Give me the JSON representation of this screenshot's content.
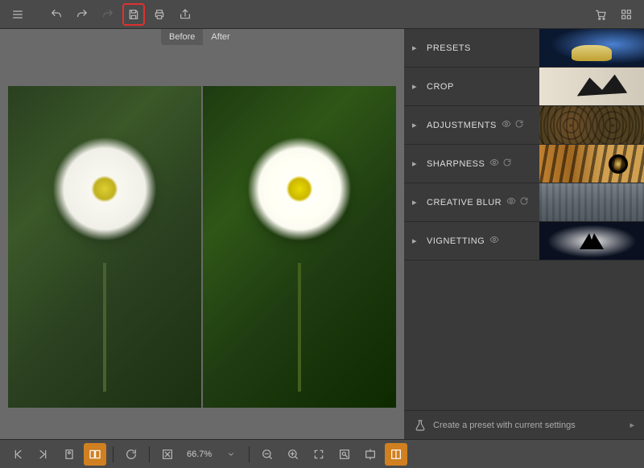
{
  "compare": {
    "before": "Before",
    "after": "After"
  },
  "panels": [
    {
      "label": "PRESETS",
      "extras": false,
      "thumb": "lamp"
    },
    {
      "label": "CROP",
      "extras": false,
      "thumb": "shadow"
    },
    {
      "label": "ADJUSTMENTS",
      "extras": true,
      "thumb": "gears"
    },
    {
      "label": "SHARPNESS",
      "extras": true,
      "thumb": "tiger"
    },
    {
      "label": "CREATIVE BLUR",
      "extras": true,
      "thumb": "city"
    },
    {
      "label": "VIGNETTING",
      "extras": false,
      "eye": true,
      "thumb": "vig"
    }
  ],
  "footer": {
    "create_preset": "Create a preset with current settings"
  },
  "zoom": {
    "value": "66.7%"
  }
}
